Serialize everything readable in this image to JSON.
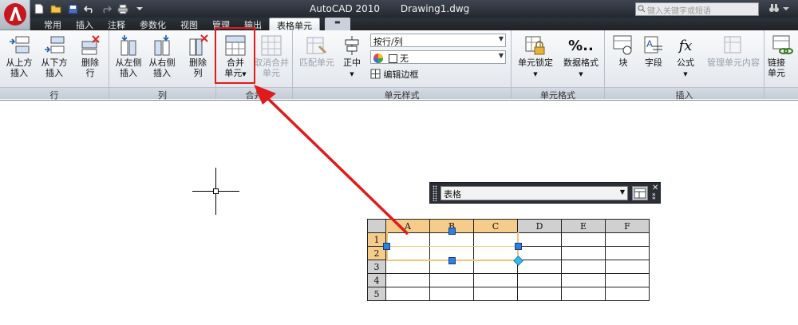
{
  "title_bar": {
    "app_name": "AutoCAD 2010",
    "document": "Drawing1.dwg",
    "search_placeholder": "键入关键字或短语"
  },
  "tabs": [
    "常用",
    "插入",
    "注释",
    "参数化",
    "视图",
    "管理",
    "输出",
    "表格单元"
  ],
  "active_tab": "表格单元",
  "ribbon": {
    "row_panel": {
      "title": "行",
      "buttons": [
        "从上方\n插入",
        "从下方\n插入",
        "删除\n行"
      ]
    },
    "column_panel": {
      "title": "列",
      "buttons": [
        "从左侧\n插入",
        "从右侧\n插入",
        "删除\n列"
      ]
    },
    "merge_panel": {
      "title": "合并",
      "merge_label": "合并\n单元",
      "unmerge_label": "取消合并\n单元"
    },
    "cell_style_panel": {
      "title": "单元样式",
      "match_label": "匹配单元",
      "align_label": "正中",
      "style_combo": "按行/列",
      "fill_combo": "无",
      "edit_borders": "编辑边框"
    },
    "cell_format_panel": {
      "title": "单元格式",
      "lock_label": "单元锁定",
      "format_label": "数据格式",
      "format_glyph": "%.."
    },
    "insert_panel": {
      "title": "插入",
      "block_label": "块",
      "field_label": "字段",
      "formula_label": "公式",
      "formula_glyph": "fx",
      "manage_label": "管理单元内容"
    },
    "data_panel": {
      "link_label": "链接\n单元"
    }
  },
  "table_toolbar": {
    "style_select": "表格"
  },
  "sheet": {
    "columns": [
      "A",
      "B",
      "C",
      "D",
      "E",
      "F"
    ],
    "rows": [
      "1",
      "2",
      "3",
      "4",
      "5"
    ],
    "selected_columns": [
      "A",
      "B",
      "C"
    ],
    "selected_rows": [
      "1",
      "2"
    ]
  },
  "colors": {
    "highlight_red": "#e01b1b",
    "selection_orange": "#f5cc8a",
    "grip_blue": "#2f7fe0"
  }
}
